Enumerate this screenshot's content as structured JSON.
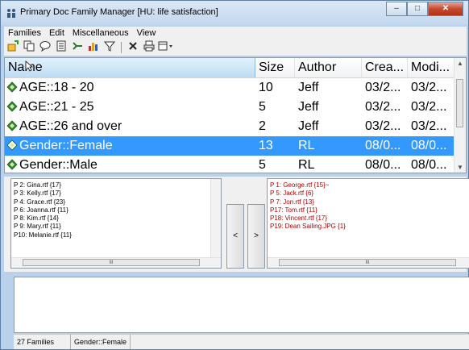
{
  "window": {
    "title": "Primary Doc Family Manager [HU: life satisfaction]",
    "controls": [
      "minimize-icon",
      "maximize-icon",
      "close-icon"
    ]
  },
  "menubar": [
    "Families",
    "Edit",
    "Miscellaneous",
    "View"
  ],
  "toolbar": [
    "new-family-icon",
    "copy-icon",
    "comment-icon",
    "document-icon",
    "merge-icon",
    "chart-icon",
    "filter-icon",
    "delete-icon",
    "print-icon",
    "view-dropdown-icon"
  ],
  "families_table": {
    "columns": [
      "Name",
      "Size",
      "Author",
      "Crea...",
      "Modi..."
    ],
    "rows": [
      {
        "name": "AGE::18 - 20",
        "size": "10",
        "author": "Jeff",
        "created": "03/2...",
        "modified": "03/2...",
        "selected": false
      },
      {
        "name": "AGE::21 - 25",
        "size": "5",
        "author": "Jeff",
        "created": "03/2...",
        "modified": "03/2...",
        "selected": false
      },
      {
        "name": "AGE::26 and over",
        "size": "2",
        "author": "Jeff",
        "created": "03/2...",
        "modified": "03/2...",
        "selected": false
      },
      {
        "name": "Gender::Female",
        "size": "13",
        "author": "RL",
        "created": "08/0...",
        "modified": "08/0...",
        "selected": true
      },
      {
        "name": "Gender::Male",
        "size": "5",
        "author": "RL",
        "created": "08/0...",
        "modified": "08/0...",
        "selected": false
      }
    ]
  },
  "members_list": [
    "P 2: Gina.rtf {17}",
    "P 3: Kelly.rtf {17}",
    "P 4: Grace.rtf {23}",
    "P 6: Joanna.rtf {11}",
    "P 8: Kim.rtf {14}",
    "P 9: Mary.rtf {11}",
    "P10: Melanie.rtf {11}"
  ],
  "move_buttons": {
    "left": "<",
    "right": ">"
  },
  "nonmembers_list": [
    "P 1: George.rtf {15}~",
    "P 5: Jack.rtf {6}",
    "P 7: Jon.rtf {13}",
    "P17: Tom.rtf {11}",
    "P18: Vincent.rtf {17}",
    "P19: Dean Sailing.JPG {1}"
  ],
  "statusbar": {
    "count": "27 Families",
    "current": "Gender::Female"
  },
  "colors": {
    "selection": "#3399ff",
    "family_icon": "#2e8b2e",
    "nonmember_text": "#aa0000"
  }
}
